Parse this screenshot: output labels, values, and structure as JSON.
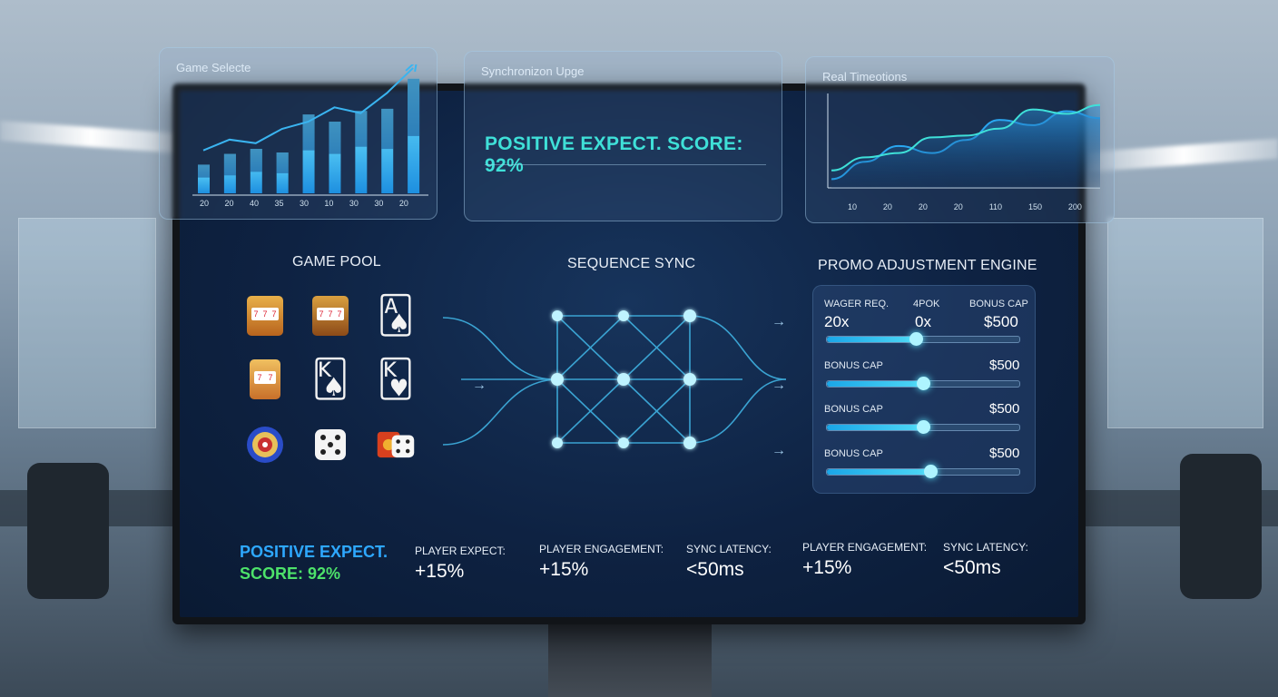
{
  "colors": {
    "accent": "#3fe0d8",
    "accent_blue": "#2ea8ff",
    "score_green": "#4de26a",
    "screen_bg": "#0e2242"
  },
  "panels": {
    "game_select": {
      "title": "Game Selecte",
      "ticks": [
        "20",
        "20",
        "40",
        "35",
        "30",
        "10",
        "30",
        "30",
        "20"
      ]
    },
    "sync": {
      "title": "Synchronizon Upge",
      "score": "POSITIVE EXPECT. SCORE: 92%"
    },
    "realtime": {
      "title": "Real Timeotions",
      "ticks": [
        "10",
        "20",
        "20",
        "20",
        "110",
        "150",
        "200"
      ]
    }
  },
  "sections": {
    "game_pool": "GAME POOL",
    "sequence_sync": "SEQUENCE SYNC",
    "promo_engine": "PROMO ADJUSTMENT ENGINE"
  },
  "game_pool": {
    "icons": [
      "slot-machine-icon",
      "slot-machine-icon",
      "playing-cards-icon",
      "slot-machine-icon",
      "playing-cards-icon",
      "playing-cards-icon",
      "roulette-icon",
      "dice-icon",
      "dice-box-icon"
    ]
  },
  "promo": {
    "header": {
      "col1_label": "WAGER REQ.",
      "col2_label": "4POK",
      "col3_label": "BONUS CAP",
      "col1_value": "20x",
      "col2_value": "0x",
      "col3_value": "$500"
    },
    "sliders": [
      {
        "level": 0.46
      },
      {
        "label": "BONUS CAP",
        "value": "$500",
        "level": 0.5
      },
      {
        "label": "BONUS CAP",
        "value": "$500",
        "level": 0.5
      },
      {
        "label": "BONUS CAP",
        "value": "$500",
        "level": 0.54
      }
    ]
  },
  "stats": {
    "score_line1": "POSITIVE EXPECT.",
    "score_line2": "SCORE: 92%",
    "items": [
      {
        "label": "PLAYER EXPECT:",
        "value": "+15%"
      },
      {
        "label": "PLAYER ENGAGEMENT:",
        "value": "+15%"
      },
      {
        "label": "SYNC LATENCY:",
        "value": "<50ms"
      },
      {
        "label": "PLAYER ENGAGEMENT:",
        "value": "+15%"
      },
      {
        "label": "SYNC LATENCY:",
        "value": "<50ms"
      }
    ]
  },
  "chart_data": [
    {
      "type": "bar",
      "categories": [
        "20",
        "20",
        "40",
        "35",
        "30",
        "10",
        "30",
        "30",
        "20"
      ],
      "values": [
        40,
        55,
        62,
        57,
        110,
        100,
        115,
        118,
        160
      ],
      "values_dark": [
        22,
        25,
        30,
        28,
        60,
        55,
        65,
        62,
        80
      ],
      "trend": [
        60,
        75,
        70,
        90,
        100,
        120,
        112,
        140,
        175
      ]
    },
    {
      "type": "area",
      "x": [
        "10",
        "20",
        "20",
        "20",
        "110",
        "150",
        "200"
      ],
      "series": [
        {
          "values": [
            10,
            30,
            48,
            40,
            55,
            78,
            72,
            88,
            80
          ]
        },
        {
          "values": [
            20,
            35,
            40,
            58,
            60,
            68,
            90,
            85,
            95
          ]
        }
      ]
    }
  ]
}
